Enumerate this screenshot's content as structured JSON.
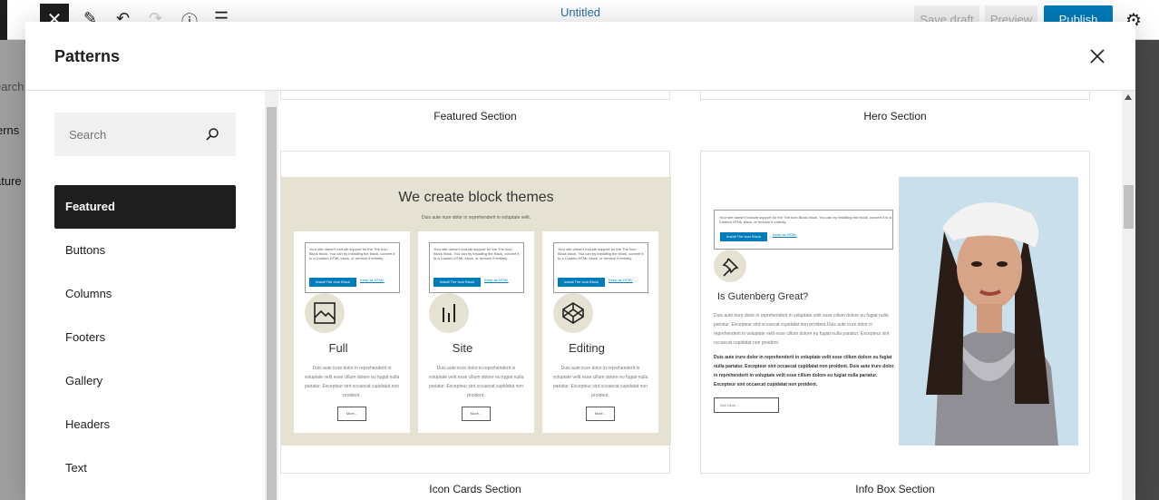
{
  "editor": {
    "title": "Untitled",
    "save_draft": "Save draft",
    "preview": "Preview",
    "publish": "Publish",
    "left_search_fragment": "earch",
    "left_patterns_fragment": "erns",
    "left_featured_fragment": "ature"
  },
  "modal": {
    "title": "Patterns",
    "search_placeholder": "Search",
    "categories": [
      {
        "label": "Featured",
        "active": true
      },
      {
        "label": "Buttons"
      },
      {
        "label": "Columns"
      },
      {
        "label": "Footers"
      },
      {
        "label": "Gallery"
      },
      {
        "label": "Headers"
      },
      {
        "label": "Text"
      }
    ]
  },
  "patterns": {
    "top_left_label": "Featured Section",
    "top_right_label": "Hero Section",
    "icon_cards": {
      "label": "Icon Cards Section",
      "heading": "We create block themes",
      "subheading": "Duis aute irure dolor in reprehenderit in voluptate velit.",
      "notice_text": "Your site doesn't include support for the The Icon Block block. You can try installing the block, convert it to a Custom HTML block, or remove it entirely.",
      "notice_button": "Install The Icon Block",
      "notice_link": "Keep as HTML",
      "body_text": "Duis aute irure dolor in reprehenderit in voluptate velit esse cillum dolore eu fugiat nulla pariatur. Excepteur sint occaecat cupidatat non proident.",
      "more": "More...",
      "cards": [
        {
          "title": "Full",
          "icon": "image-icon"
        },
        {
          "title": "Site",
          "icon": "chart-bars-icon"
        },
        {
          "title": "Editing",
          "icon": "codepen-icon"
        }
      ]
    },
    "info_box": {
      "label": "Info Box Section",
      "notice_text": "Your site doesn't include support for the The Icon Block block. You can try installing the block, convert it to a Custom HTML block, or remove it entirely.",
      "notice_button": "Install The Icon Block",
      "notice_link": "Keep as HTML",
      "heading": "Is Gutenberg Great?",
      "para1": "Duis aute irure dolor in reprehenderit in voluptate velit esse cillum dolore eu fugiat nulla pariatur. Excepteur sint occaecat cupidatat non proident.Duis aute irure dolor in reprehenderit in voluptate velit esse cillum dolore eu fugiat nulla pariatur. Excepteur sint occaecat cupidatat non proident.",
      "para2": "Duis aute irure dolor in reprehenderit in voluptate velit esse cillum dolore eu fugiat nulla pariatur. Excepteur sint occaecat cupidatat non proident. Duis aute irure dolor in reprehenderit in voluptate velit esse cillum dolore eu fugiat nulla pariatur. Excepteur sint occaecat cupidatat non proident.",
      "more": "See More..."
    }
  },
  "colors": {
    "accent": "#007cba",
    "beige": "#e6e2d3",
    "dark": "#1e1e1e"
  }
}
